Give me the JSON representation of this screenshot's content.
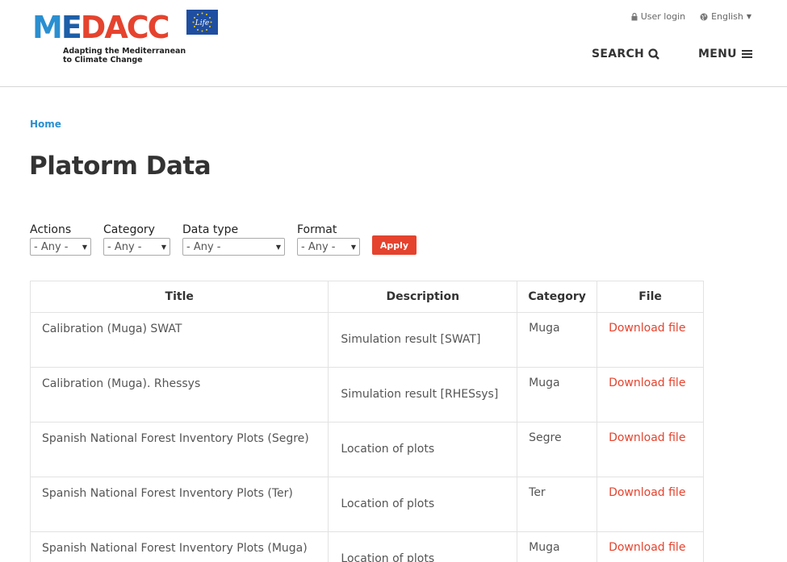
{
  "header": {
    "logo_text": {
      "part1": "M",
      "part2": "E",
      "part3": "DACC"
    },
    "tagline_line1": "Adapting the Mediterranean",
    "tagline_line2": "to Climate Change",
    "flag_text": "Life",
    "user_login": "User login",
    "language": "English",
    "search_label": "SEARCH",
    "menu_label": "MENU"
  },
  "breadcrumb": {
    "home": "Home"
  },
  "page": {
    "title": "Platorm Data"
  },
  "filters": {
    "actions": {
      "label": "Actions",
      "value": "- Any -"
    },
    "category": {
      "label": "Category",
      "value": "- Any -"
    },
    "data_type": {
      "label": "Data type",
      "value": "- Any -"
    },
    "format": {
      "label": "Format",
      "value": "- Any -"
    },
    "apply_label": "Apply"
  },
  "table": {
    "headers": {
      "title": "Title",
      "description": "Description",
      "category": "Category",
      "file": "File"
    },
    "rows": [
      {
        "title": "Calibration (Muga) SWAT",
        "description": "Simulation result [SWAT]",
        "category": "Muga",
        "file": "Download file"
      },
      {
        "title": "Calibration (Muga). Rhessys",
        "description": "Simulation result [RHESsys]",
        "category": "Muga",
        "file": "Download file"
      },
      {
        "title": "Spanish National Forest Inventory Plots (Segre)",
        "description": "Location of plots",
        "category": "Segre",
        "file": "Download file"
      },
      {
        "title": "Spanish National Forest Inventory Plots (Ter)",
        "description": "Location of plots",
        "category": "Ter",
        "file": "Download file"
      },
      {
        "title": "Spanish National Forest Inventory Plots (Muga)",
        "description": "Location of plots",
        "category": "Muga",
        "file": "Download file"
      }
    ]
  },
  "colors": {
    "accent": "#e5432e",
    "link": "#2a8fd0",
    "brand_dark": "#1c5fa8",
    "eu_blue": "#1f4ea1"
  }
}
